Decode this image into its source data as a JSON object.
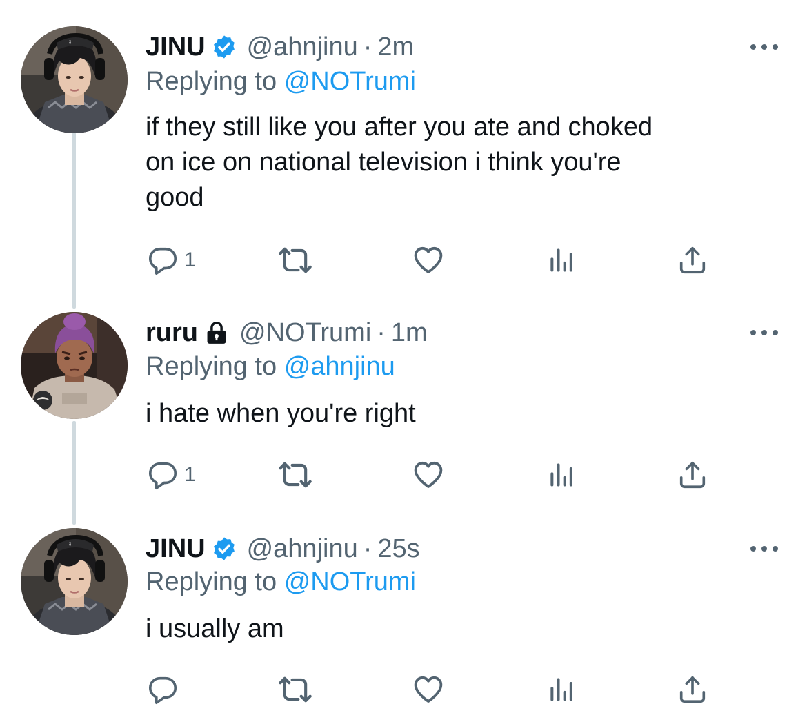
{
  "colors": {
    "accent": "#1d9bf0",
    "secondary_text": "#536471",
    "primary_text": "#0f1419",
    "thread_line": "#cfd9de"
  },
  "tweets": [
    {
      "avatar_icon": "user-avatar-jinu",
      "name": "JINU",
      "verified": true,
      "handle": "@ahnjinu",
      "separator": "·",
      "time": "2m",
      "replying_prefix": "Replying to",
      "replying_to": "@NOTrumi",
      "text": "if they still like you after you ate and choked\non ice on national television i think you're\ngood",
      "reply_count": "1"
    },
    {
      "avatar_icon": "user-avatar-ruru",
      "name": "ruru",
      "protected": true,
      "handle": "@NOTrumi",
      "separator": "·",
      "time": "1m",
      "replying_prefix": "Replying to",
      "replying_to": "@ahnjinu",
      "text": "i hate when you're right",
      "reply_count": "1"
    },
    {
      "avatar_icon": "user-avatar-jinu",
      "name": "JINU",
      "verified": true,
      "handle": "@ahnjinu",
      "separator": "·",
      "time": "25s",
      "replying_prefix": "Replying to",
      "replying_to": "@NOTrumi",
      "text": "i usually am",
      "reply_count": ""
    }
  ]
}
